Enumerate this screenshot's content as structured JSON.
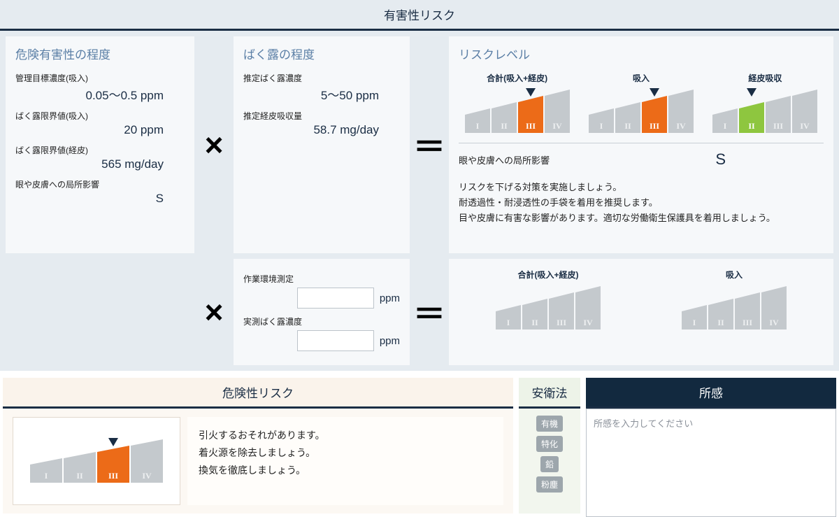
{
  "header1": "有害性リスク",
  "colA": {
    "title": "危険有害性の程度",
    "items": [
      {
        "label": "管理目標濃度(吸入)",
        "value": "0.05～0.5 ppm"
      },
      {
        "label": "ばく露限界値(吸入)",
        "value": "20 ppm"
      },
      {
        "label": "ばく露限界値(経皮)",
        "value": "565 mg/day"
      },
      {
        "label": "眼や皮膚への局所影響",
        "value": "S"
      }
    ]
  },
  "op_times": "×",
  "op_eq": "＝",
  "colB": {
    "title": "ばく露の程度",
    "items": [
      {
        "label": "推定ばく露濃度",
        "value": "5～50 ppm"
      },
      {
        "label": "推定経皮吸収量",
        "value": "58.7 mg/day"
      }
    ],
    "items2": [
      {
        "label": "作業環境測定",
        "unit": "ppm"
      },
      {
        "label": "実測ばく露濃度",
        "unit": "ppm"
      }
    ]
  },
  "colC": {
    "title": "リスクレベル",
    "gauges": [
      {
        "head": "合計(吸入+経皮)",
        "level": 3,
        "color": "orange"
      },
      {
        "head": "吸入",
        "level": 3,
        "color": "orange"
      },
      {
        "head": "経皮吸収",
        "level": 2,
        "color": "green"
      }
    ],
    "local_label": "眼や皮膚への局所影響",
    "local_value": "S",
    "advice": [
      "リスクを下げる対策を実施しましょう。",
      "耐透過性・耐浸透性の手袋を着用を推奨します。",
      "目や皮膚に有害な影響があります。適切な労働衛生保護具を着用しましょう。"
    ],
    "gauges2": [
      {
        "head": "合計(吸入+経皮)",
        "level": 0
      },
      {
        "head": "吸入",
        "level": 0
      }
    ]
  },
  "danger": {
    "header": "危険性リスク",
    "gauge": {
      "level": 3,
      "color": "orange"
    },
    "advice": [
      "引火するおそれがあります。",
      "着火源を除去しましょう。",
      "換気を徹底しましょう。"
    ]
  },
  "law": {
    "header": "安衛法",
    "badges": [
      "有機",
      "特化",
      "鉛",
      "粉塵"
    ]
  },
  "note": {
    "header": "所感",
    "placeholder": "所感を入力してください"
  },
  "roman": [
    "I",
    "II",
    "III",
    "IV"
  ],
  "colors": {
    "orange": "#ec6b18",
    "green": "#8ec63f",
    "grey": "#c4c9cd",
    "label": "#e9eaeb"
  }
}
